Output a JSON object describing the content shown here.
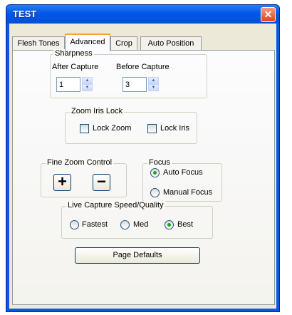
{
  "window": {
    "title": "TEST",
    "close_glyph": "✕"
  },
  "tabs": [
    {
      "label": "Flesh Tones"
    },
    {
      "label": "Advanced"
    },
    {
      "label": "Crop"
    },
    {
      "label": "Auto Position"
    }
  ],
  "active_tab": "Advanced",
  "sharpness": {
    "legend": "Sharpness",
    "after_label": "After Capture",
    "after_value": "1",
    "before_label": "Before Capture",
    "before_value": "3"
  },
  "zoom_iris": {
    "legend": "Zoom Iris Lock",
    "lock_zoom": "Lock Zoom",
    "lock_iris": "Lock Iris"
  },
  "fine_zoom": {
    "legend": "Fine Zoom Control",
    "plus": "+",
    "minus": "−"
  },
  "focus": {
    "legend": "Focus",
    "auto": "Auto Focus",
    "manual": "Manual Focus",
    "selected": "Auto Focus"
  },
  "live_capture": {
    "legend": "Live Capture Speed/Quality",
    "fastest": "Fastest",
    "med": "Med",
    "best": "Best",
    "selected": "Best"
  },
  "page_defaults_label": "Page Defaults",
  "colors": {
    "title_blue": "#0058e6",
    "close_red": "#e0431f",
    "tab_highlight": "#f1a82d"
  }
}
